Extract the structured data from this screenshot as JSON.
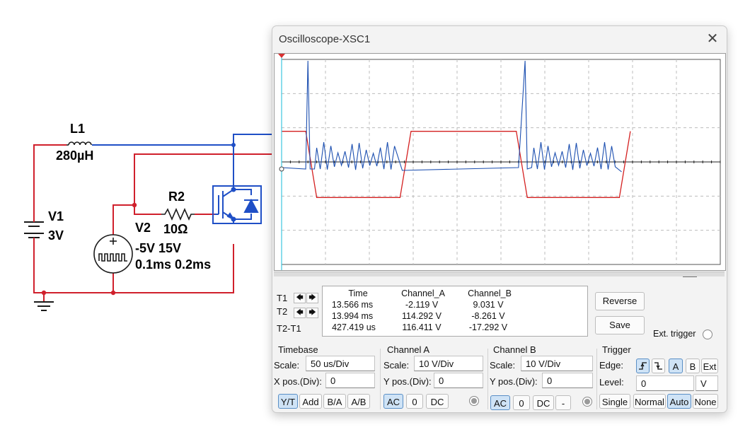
{
  "colors": {
    "wire_red": "#d0202c",
    "wire_blue": "#1f4fc6",
    "trace_a": "#d42020",
    "trace_b": "#1c4fb0",
    "grid": "#bcbcbc",
    "cursor_t1": "#3ec6e0",
    "cursor_t2": "#1f3fa8"
  },
  "schematic": {
    "l1_name": "L1",
    "l1_value": "280µH",
    "v1_name": "V1",
    "v1_value": "3V",
    "r2_name": "R2",
    "r2_value": "10Ω",
    "v2_name": "V2",
    "v2_levels": "-5V 15V",
    "v2_timing": "0.1ms 0.2ms",
    "icons": [
      "ground-icon",
      "battery-icon",
      "pulse-source-icon",
      "igbt-icon",
      "inductor-icon",
      "resistor-icon"
    ]
  },
  "scope": {
    "title": "Oscilloscope-XSC1",
    "close_icon": "close-icon",
    "t1_label": "T1",
    "t2_label": "T2",
    "diff_label": "T2-T1",
    "readout": {
      "headers": [
        "Time",
        "Channel_A",
        "Channel_B"
      ],
      "rows": [
        [
          "13.566 ms",
          "-2.119 V",
          "9.031 V"
        ],
        [
          "13.994 ms",
          "114.292 V",
          "-8.261 V"
        ],
        [
          "427.419 us",
          "116.411 V",
          "-17.292 V"
        ]
      ]
    },
    "reverse_label": "Reverse",
    "save_label": "Save",
    "ext_trigger_label": "Ext. trigger",
    "timebase": {
      "title": "Timebase",
      "scale_label": "Scale:",
      "scale_value": "50 us/Div",
      "xpos_label": "X pos.(Div):",
      "xpos_value": "0",
      "modes": [
        "Y/T",
        "Add",
        "B/A",
        "A/B"
      ],
      "active_mode": "Y/T"
    },
    "channel_a": {
      "title": "Channel A",
      "scale_label": "Scale:",
      "scale_value": "10  V/Div",
      "ypos_label": "Y pos.(Div):",
      "ypos_value": "0",
      "coupling": [
        "AC",
        "0",
        "DC"
      ],
      "active": "AC"
    },
    "channel_b": {
      "title": "Channel B",
      "scale_label": "Scale:",
      "scale_value": "10  V/Div",
      "ypos_label": "Y pos.(Div):",
      "ypos_value": "0",
      "coupling": [
        "AC",
        "0",
        "DC",
        "-"
      ],
      "active": "AC"
    },
    "trigger": {
      "title": "Trigger",
      "edge_label": "Edge:",
      "level_label": "Level:",
      "level_value": "0",
      "level_unit": "V",
      "sources": [
        "A",
        "B",
        "Ext"
      ],
      "active_source": "A",
      "modes": [
        "Single",
        "Normal",
        "Auto",
        "None"
      ],
      "active_mode": "Auto",
      "edge_icons": [
        "rising-edge-icon",
        "falling-edge-icon"
      ]
    }
  },
  "chart_data": {
    "type": "line",
    "xlabel": "",
    "ylabel": "",
    "x_divisions": 10,
    "y_divisions": 6,
    "x_scale": "50 us/Div",
    "y_scale": "10  V/Div",
    "grid": true,
    "series": [
      {
        "channel": "A",
        "shape": "square wave: high plateau ~ +1 div, low plateau ~ -1 div, transitions ~0.2 div wide, period ~5 div",
        "color": "#d42020"
      },
      {
        "channel": "B",
        "shape": "ringing burst after each spike, tall spikes at each falling edge of A, near 0 otherwise",
        "color": "#1c4fb0"
      }
    ]
  }
}
